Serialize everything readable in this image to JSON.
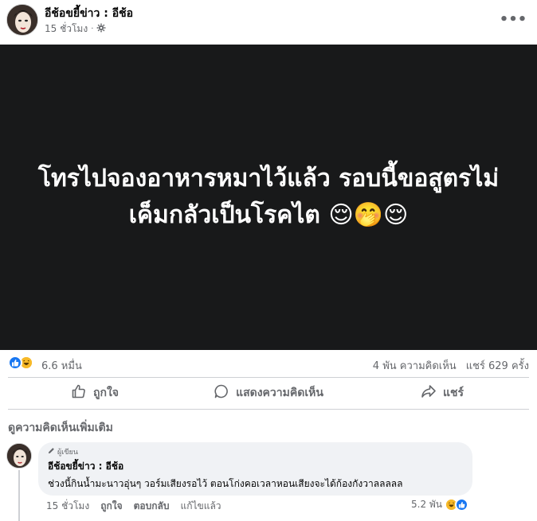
{
  "post": {
    "author": "อีช้อขยี้ข่าว : อีช้อ",
    "time": "15 ชั่วโมง",
    "separator": "·",
    "more_icon": "more-horizontal-icon",
    "media_text": "โทรไปจองอาหารหมาไว้แล้ว รอบนี้ขอสูตรไม่เค็มกลัวเป็นโรคไต 😌🤭😌"
  },
  "stats": {
    "reaction_count": "6.6 หมื่น",
    "comments": "4 พัน ความคิดเห็น",
    "shares": "แชร์ 629 ครั้ง"
  },
  "actions": {
    "like": "ถูกใจ",
    "comment": "แสดงความคิดเห็น",
    "share": "แชร์"
  },
  "comments_section": {
    "more_label": "ดูความคิดเห็นเพิ่มเติม",
    "comment": {
      "badge": "ผู้เขียน",
      "author": "อีช้อขยี้ข่าว : อีช้อ",
      "text": "ช่วงนี้กินน้ำมะนาวอุ่นๆ วอร์มเสียงรอไว้ ตอนโก่งคอเวลาหอนเสียงจะได้ก้องกังวาลลลลล",
      "time": "15 ชั่วโมง",
      "like": "ถูกใจ",
      "reply": "ตอบกลับ",
      "edited": "แก้ไขแล้ว",
      "reaction_count": "5.2 พัน"
    }
  },
  "colors": {
    "like_blue": "#1877f2",
    "haha_yellow": "#f7b928",
    "media_bg": "#18191a",
    "secondary_text": "#65676b"
  }
}
